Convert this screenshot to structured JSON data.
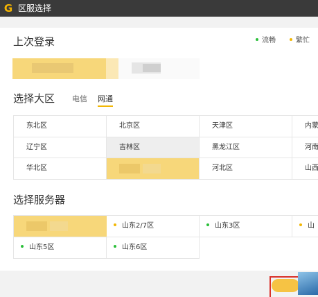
{
  "window": {
    "title": "区服选择",
    "logo": "G"
  },
  "last_login": {
    "title": "上次登录"
  },
  "legend": [
    {
      "label": "流畅",
      "color": "#2bbf3a"
    },
    {
      "label": "繁忙",
      "color": "#f2b705"
    }
  ],
  "zone_select": {
    "title": "选择大区",
    "tabs": [
      {
        "label": "电信",
        "active": false
      },
      {
        "label": "网通",
        "active": true
      }
    ],
    "zones": [
      "东北区",
      "北京区",
      "天津区",
      "内蒙",
      "辽宁区",
      "吉林区",
      "黑龙江区",
      "河南",
      "华北区",
      "",
      "河北区",
      "山西"
    ]
  },
  "server_select": {
    "title": "选择服务器",
    "servers": [
      {
        "name": "",
        "status": ""
      },
      {
        "name": "山东2/7区",
        "status": "busy"
      },
      {
        "name": "山东3区",
        "status": "smooth"
      },
      {
        "name": "山",
        "status": "busy"
      },
      {
        "name": "山东5区",
        "status": "smooth"
      },
      {
        "name": "山东6区",
        "status": "smooth"
      }
    ]
  },
  "colors": {
    "smooth": "#2bbf3a",
    "busy": "#f2b705",
    "accent": "#f6c344",
    "titlebar": "#3a3a3a"
  }
}
